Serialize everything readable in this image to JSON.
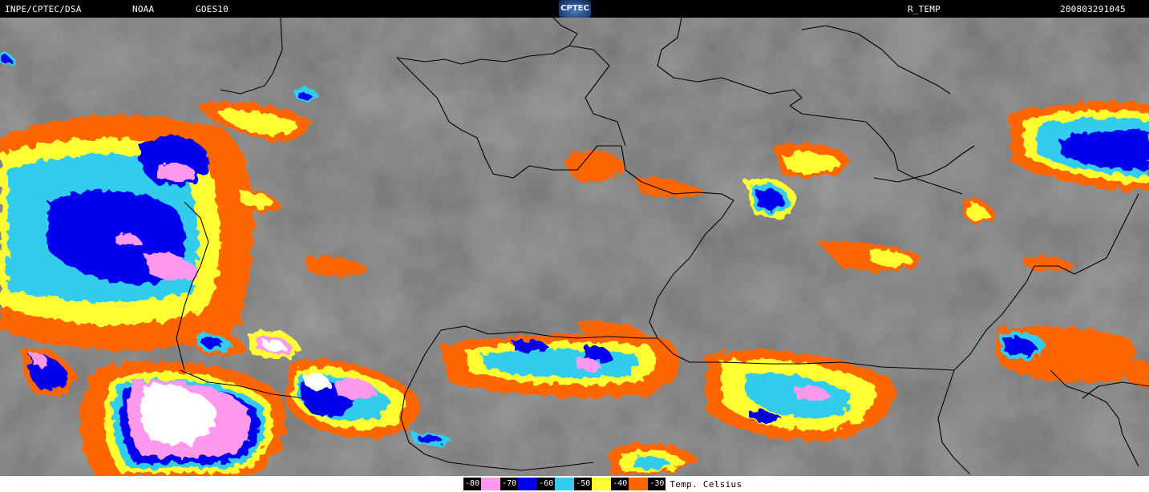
{
  "header": {
    "source": "INPE/CPTEC/DSA",
    "agency": "NOAA",
    "satellite": "GOES10",
    "logo_text": "CPTEC",
    "product": "R_TEMP",
    "timestamp": "200803291045"
  },
  "legend": {
    "items": [
      {
        "label": "-80",
        "color": "#ff99ee"
      },
      {
        "label": "-70",
        "color": "#0000ee"
      },
      {
        "label": "-60",
        "color": "#33ccee"
      },
      {
        "label": "-50",
        "color": "#ffff33"
      },
      {
        "label": "-40",
        "color": "#ff6600"
      },
      {
        "label": "-30",
        "color": null
      }
    ],
    "unit": "Temp. Celsius"
  },
  "map": {
    "background": "#6a6a6a",
    "border_color": "#000000"
  }
}
